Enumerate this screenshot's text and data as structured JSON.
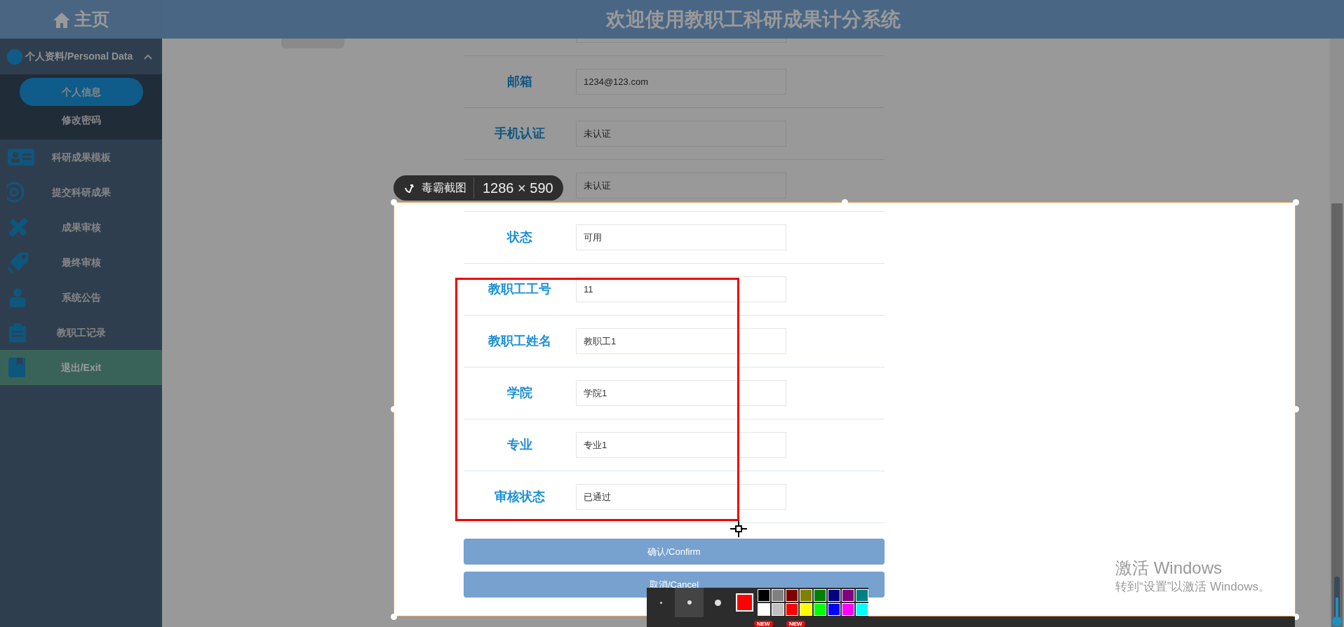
{
  "header": {
    "home": "主页",
    "title": "欢迎使用教职工科研成果计分系统"
  },
  "sidebar": {
    "group": {
      "label": "个人资料/Personal Data",
      "expanded": true,
      "children": [
        {
          "label": "个人信息",
          "selected": true
        },
        {
          "label": "修改密码",
          "selected": false
        }
      ]
    },
    "items": [
      {
        "label": "科研成果模板",
        "selected": false
      },
      {
        "label": "提交科研成果",
        "selected": false
      },
      {
        "label": "成果审核",
        "selected": false
      },
      {
        "label": "最终审核",
        "selected": false
      },
      {
        "label": "系统公告",
        "selected": false
      },
      {
        "label": "教职工记录",
        "selected": false
      },
      {
        "label": "退出/Exit",
        "selected": true
      }
    ]
  },
  "form": {
    "rows": [
      {
        "label": "邮箱",
        "value": "1234@123.com"
      },
      {
        "label": "手机认证",
        "value": "未认证"
      },
      {
        "value": "未认证"
      },
      {
        "label": "状态",
        "value": "可用"
      },
      {
        "label": "教职工工号",
        "value": "11"
      },
      {
        "label": "教职工姓名",
        "value": "教职工1"
      },
      {
        "label": "学院",
        "value": "学院1"
      },
      {
        "label": "专业",
        "value": "专业1"
      },
      {
        "label": "审核状态",
        "value": "已通过"
      }
    ],
    "buttons": [
      "确认/Confirm",
      "取消/Cancel"
    ]
  },
  "capture": {
    "app": "毒霸截图",
    "size": "1286 × 590",
    "pen_sizes": [
      {
        "selected": false
      },
      {
        "selected": true
      },
      {
        "selected": false
      }
    ],
    "current": {
      "color": "#ff0000"
    },
    "palette": [
      {
        "color": "#000000"
      },
      {
        "color": "#808080"
      },
      {
        "color": "#800000"
      },
      {
        "color": "#808000"
      },
      {
        "color": "#008000"
      },
      {
        "color": "#000080"
      },
      {
        "color": "#800080"
      },
      {
        "color": "#008080"
      },
      {
        "color": "#ffffff"
      },
      {
        "color": "#c0c0c0"
      },
      {
        "color": "#ff0000"
      },
      {
        "color": "#ffff00"
      },
      {
        "color": "#00ff00"
      },
      {
        "color": "#0000ff"
      },
      {
        "color": "#ff00ff"
      },
      {
        "color": "#00ffff"
      }
    ],
    "badges": [
      "NEW",
      "NEW"
    ]
  },
  "os_notice": {
    "title": "激活 Windows",
    "text": "转到“设置”以激活 Windows。"
  }
}
